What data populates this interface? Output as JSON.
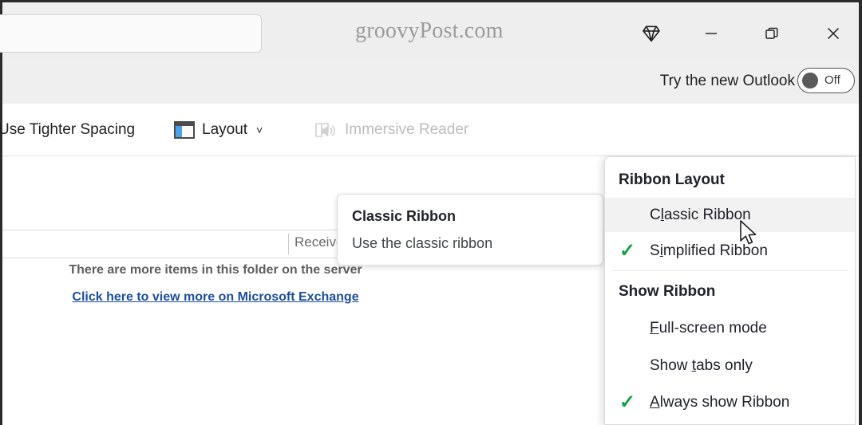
{
  "window": {
    "watermark": "groovyPost.com",
    "controls": [
      {
        "name": "diamond-icon",
        "label": "Diamond"
      },
      {
        "name": "minimize-button",
        "label": "Minimize"
      },
      {
        "name": "restore-button",
        "label": "Restore Down"
      },
      {
        "name": "close-button",
        "label": "Close"
      }
    ]
  },
  "search": {
    "value": "",
    "placeholder": ""
  },
  "new_outlook": {
    "label": "Try the new Outlook",
    "toggle_state": "Off"
  },
  "ribbon": {
    "tighter_spacing": "Use Tighter Spacing",
    "layout": "Layout",
    "layout_chevron": "˅",
    "immersive_reader": "Immersive Reader",
    "overflow": "•••",
    "expand_chevron": "˅"
  },
  "mail": {
    "column_received": "Received",
    "more_items": "There are more items in this folder on the server",
    "exchange_link": "Click here to view more on Microsoft Exchange"
  },
  "tooltip": {
    "title": "Classic Ribbon",
    "description": "Use the classic ribbon"
  },
  "menu": {
    "sections": [
      {
        "header": "Ribbon Layout",
        "items": [
          {
            "pre": "C",
            "acc": "l",
            "post": "assic Ribbon",
            "checked": false,
            "highlighted": true
          },
          {
            "pre": "S",
            "acc": "i",
            "post": "mplified Ribbon",
            "checked": true,
            "highlighted": false
          }
        ]
      },
      {
        "header": "Show Ribbon",
        "items": [
          {
            "pre": "",
            "acc": "F",
            "post": "ull-screen mode",
            "checked": false,
            "highlighted": false
          },
          {
            "pre": "Show ",
            "acc": "t",
            "post": "abs only",
            "checked": false,
            "highlighted": false
          },
          {
            "pre": "",
            "acc": "A",
            "post": "lways show Ribbon",
            "checked": true,
            "highlighted": false
          }
        ]
      }
    ],
    "check_glyph": "✓"
  },
  "colors": {
    "accent_blue": "#1d4f9c",
    "check_green": "#12a045",
    "layout_icon_blue": "#4aa3e8",
    "chrome_gray": "#eeeeee",
    "border_dark": "#2b2b2b"
  }
}
